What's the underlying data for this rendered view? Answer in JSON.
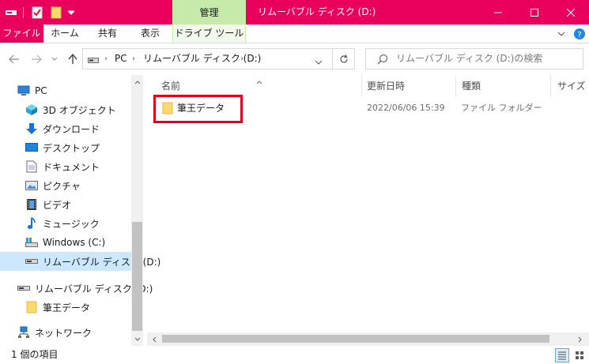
{
  "window": {
    "title": "リムーバブル ディスク (D:)",
    "accent_color": "#e8005c",
    "contextual_tab_color": "#c6eaa9"
  },
  "ribbon": {
    "contextual_group": "管理",
    "tabs": [
      "ファイル",
      "ホーム",
      "共有",
      "表示",
      "ドライブ ツール"
    ]
  },
  "address": {
    "crumbs": [
      "PC",
      "リムーバブル ディスク (D:)"
    ]
  },
  "search": {
    "placeholder": "リムーバブル ディスク (D:)の検索"
  },
  "nav": {
    "items": [
      {
        "label": "PC",
        "icon": "pc-icon"
      },
      {
        "label": "3D オブジェクト",
        "icon": "3d-objects-icon"
      },
      {
        "label": "ダウンロード",
        "icon": "download-icon"
      },
      {
        "label": "デスクトップ",
        "icon": "desktop-icon"
      },
      {
        "label": "ドキュメント",
        "icon": "document-icon"
      },
      {
        "label": "ピクチャ",
        "icon": "picture-icon"
      },
      {
        "label": "ビデオ",
        "icon": "video-icon"
      },
      {
        "label": "ミュージック",
        "icon": "music-icon"
      },
      {
        "label": "Windows (C:)",
        "icon": "windows-drive-icon"
      },
      {
        "label": "リムーバブル ディスク (D:)",
        "icon": "removable-drive-icon",
        "selected": true
      },
      {
        "label": "リムーバブル ディスク (D:)",
        "icon": "removable-drive-icon"
      },
      {
        "label": "筆王データ",
        "icon": "folder-icon"
      },
      {
        "label": "ネットワーク",
        "icon": "network-icon"
      }
    ]
  },
  "columns": [
    "名前",
    "更新日時",
    "種類",
    "サイズ"
  ],
  "files": [
    {
      "name": "筆王データ",
      "modified": "2022/06/06 15:39",
      "type": "ファイル フォルダー",
      "highlighted": true,
      "highlight_color": "#e0001b"
    }
  ],
  "status": {
    "item_count": "1 個の項目"
  }
}
